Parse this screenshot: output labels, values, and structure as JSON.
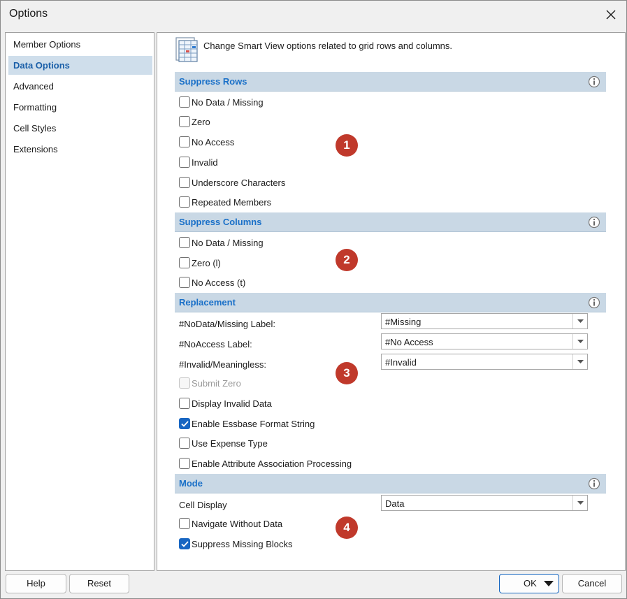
{
  "window": {
    "title": "Options"
  },
  "nav": {
    "items": [
      {
        "label": "Member Options"
      },
      {
        "label": "Data Options"
      },
      {
        "label": "Advanced"
      },
      {
        "label": "Formatting"
      },
      {
        "label": "Cell Styles"
      },
      {
        "label": "Extensions"
      }
    ],
    "selected": "Data Options"
  },
  "header": {
    "description": "Change Smart View options related to grid rows and columns.",
    "icon": "grid-options-icon"
  },
  "suppress_rows": {
    "title": "Suppress Rows",
    "options": [
      {
        "label": "No Data / Missing",
        "checked": false
      },
      {
        "label": "Zero",
        "checked": false
      },
      {
        "label": "No Access",
        "checked": false
      },
      {
        "label": "Invalid",
        "checked": false
      },
      {
        "label": "Underscore Characters",
        "checked": false
      },
      {
        "label": "Repeated Members",
        "checked": false
      }
    ]
  },
  "suppress_columns": {
    "title": "Suppress Columns",
    "options": [
      {
        "label": "No Data / Missing",
        "checked": false
      },
      {
        "label": "Zero (l)",
        "checked": false
      },
      {
        "label": "No Access (t)",
        "checked": false
      }
    ]
  },
  "replacement": {
    "title": "Replacement",
    "fields": [
      {
        "label": "#NoData/Missing Label:",
        "value": "#Missing"
      },
      {
        "label": "#NoAccess Label:",
        "value": "#No Access"
      },
      {
        "label": "#Invalid/Meaningless:",
        "value": "#Invalid"
      }
    ],
    "options": [
      {
        "label": "Submit Zero",
        "checked": false,
        "disabled": true
      },
      {
        "label": "Display Invalid Data",
        "checked": false
      },
      {
        "label": "Enable Essbase Format String",
        "checked": true
      },
      {
        "label": "Use Expense Type",
        "checked": false
      },
      {
        "label": "Enable Attribute Association Processing",
        "checked": false
      }
    ]
  },
  "mode": {
    "title": "Mode",
    "cell_display": {
      "label": "Cell Display",
      "value": "Data"
    },
    "options": [
      {
        "label": "Navigate Without Data",
        "checked": false
      },
      {
        "label": "Suppress Missing Blocks",
        "checked": true
      }
    ]
  },
  "badges": [
    "1",
    "2",
    "3",
    "4"
  ],
  "buttons": {
    "help": "Help",
    "reset": "Reset",
    "ok": "OK",
    "cancel": "Cancel"
  },
  "colors": {
    "accent": "#1a70c8",
    "section_bg": "#c9d8e5",
    "badge": "#c0392b",
    "checkbox_checked": "#1866c2"
  }
}
